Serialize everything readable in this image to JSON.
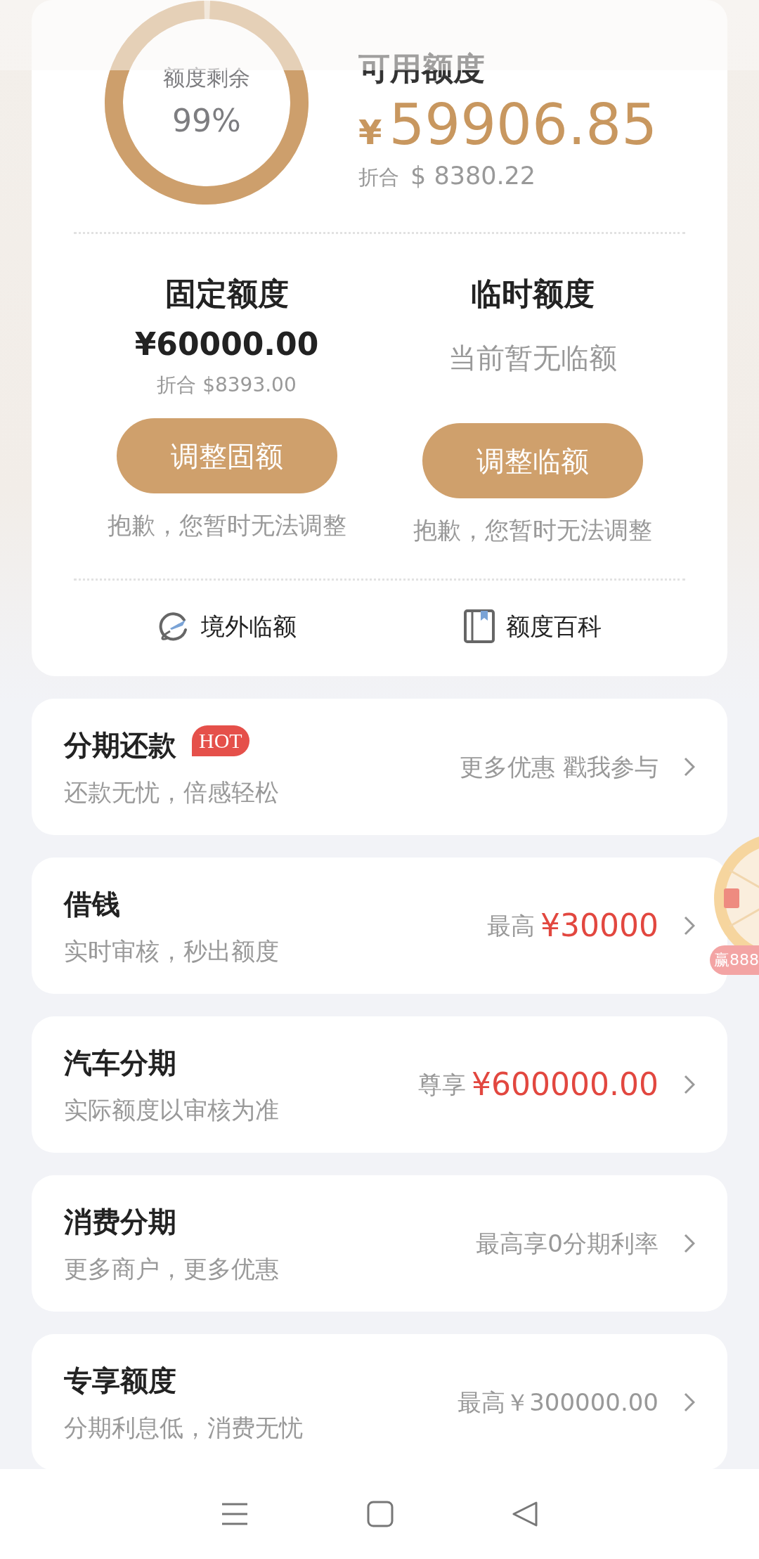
{
  "ring": {
    "label": "额度剩余",
    "value": "99%",
    "level": 0.99
  },
  "available": {
    "label": "可用额度",
    "currency": "¥",
    "amount": "59906.85",
    "converted_label": "折合",
    "converted": "$ 8380.22"
  },
  "quotas": [
    {
      "title": "固定额度",
      "amount": "¥60000.00",
      "converted": "折合 $8393.00",
      "button": "调整固额",
      "note": "抱歉，您暂时无法调整"
    },
    {
      "title": "临时额度",
      "status": "当前暂无临额",
      "button": "调整临额",
      "note": "抱歉，您暂时无法调整"
    }
  ],
  "links": [
    {
      "kind": "plane",
      "label": "境外临额"
    },
    {
      "kind": "book",
      "label": "额度百科"
    }
  ],
  "services": [
    {
      "title": "分期还款",
      "badge": "HOT",
      "subtitle": "还款无忧，倍感轻松",
      "offer": [
        {
          "text": "更多优惠 戳我参与",
          "highlight": false
        }
      ]
    },
    {
      "title": "借钱",
      "subtitle": "实时审核，秒出额度",
      "offer": [
        {
          "text": "最高",
          "highlight": false
        },
        {
          "text": "¥30000",
          "highlight": true
        }
      ]
    },
    {
      "title": "汽车分期",
      "subtitle": "实际额度以审核为准",
      "offer": [
        {
          "text": "尊享",
          "highlight": false
        },
        {
          "text": "¥600000.00",
          "highlight": true
        }
      ]
    },
    {
      "title": "消费分期",
      "subtitle": "更多商户，更多优惠",
      "offer": [
        {
          "text": "最高享0分期利率",
          "highlight": false
        }
      ]
    },
    {
      "title": "专享额度",
      "subtitle": "分期利息低，消费无忧",
      "offer": [
        {
          "text": "最高￥300000.00",
          "highlight": false
        }
      ]
    }
  ],
  "float_widget": {
    "label": "赢888"
  }
}
